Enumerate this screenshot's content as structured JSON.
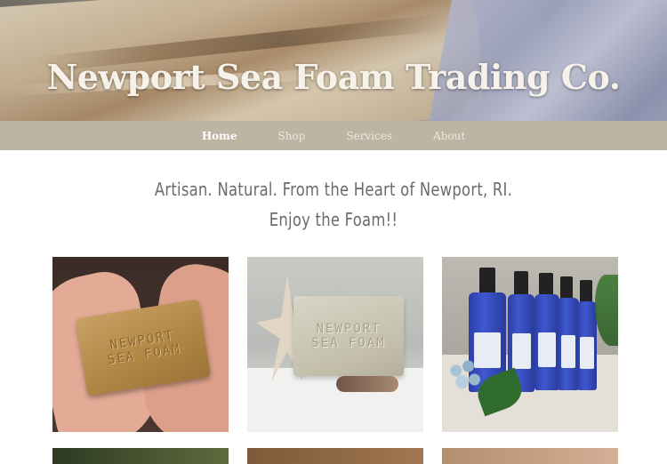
{
  "site": {
    "title": "Newport Sea Foam Trading Co."
  },
  "nav": {
    "items": [
      {
        "label": "Home",
        "active": true
      },
      {
        "label": "Shop",
        "active": false
      },
      {
        "label": "Services",
        "active": false
      },
      {
        "label": "About",
        "active": false
      }
    ]
  },
  "tagline": {
    "line1": "Artisan. Natural. From the Heart of Newport, RI.",
    "line2": "Enjoy the Foam!!"
  },
  "gallery": {
    "soap1": {
      "line1": "NEWPORT",
      "line2": "SEA FOAM"
    },
    "soap2": {
      "line1": "NEWPORT",
      "line2": "SEA FOAM"
    }
  },
  "colors": {
    "nav_bg": "#bdb4a3",
    "nav_text": "#eee9df",
    "tagline_text": "#6b6b6b"
  }
}
